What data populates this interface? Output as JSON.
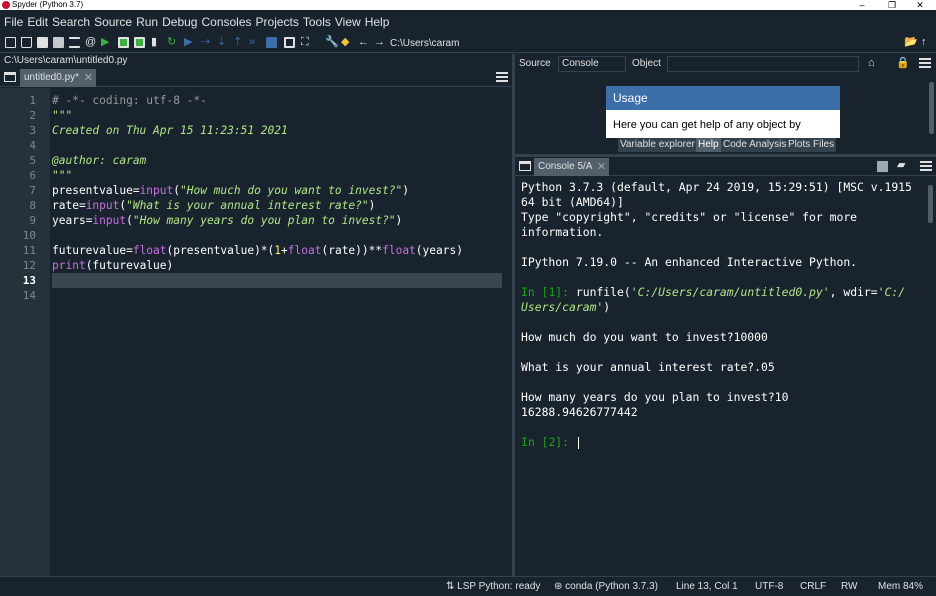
{
  "window": {
    "title": "Spyder (Python 3.7)",
    "controls": [
      "–",
      "❐",
      "✕"
    ]
  },
  "menu": [
    "File",
    "Edit",
    "Search",
    "Source",
    "Run",
    "Debug",
    "Consoles",
    "Projects",
    "Tools",
    "View",
    "Help"
  ],
  "toolbar": {
    "path": "C:\\Users\\caram",
    "icons": [
      "new-file-icon",
      "open-file-icon",
      "save-icon",
      "save-all-icon",
      "file-list-icon",
      "at-icon",
      "run-icon",
      "run-cell-icon",
      "run-cell-advance-icon",
      "run-selection-icon",
      "rerun-icon",
      "debug-icon",
      "step-icon",
      "step-into-icon",
      "step-return-icon",
      "continue-icon",
      "stop-icon",
      "maximize-pane-icon",
      "fullscreen-icon",
      "preferences-icon",
      "python-path-icon",
      "back-icon",
      "forward-icon",
      "browse-folder-icon",
      "parent-folder-icon"
    ]
  },
  "editor": {
    "file_path": "C:\\Users\\caram\\untitled0.py",
    "tab_label": "untitled0.py*",
    "line_numbers": [
      "1",
      "2",
      "3",
      "4",
      "5",
      "6",
      "7",
      "8",
      "9",
      "10",
      "11",
      "12",
      "13",
      "14"
    ],
    "current_line": 13,
    "lines": [
      [
        {
          "t": "# -*- coding: utf-8 -*-",
          "c": "c-cmt"
        }
      ],
      [
        {
          "t": "\"\"\"",
          "c": "c-str"
        }
      ],
      [
        {
          "t": "Created on Thu Apr 15 11:23:51 2021",
          "c": "c-str"
        }
      ],
      [],
      [
        {
          "t": "@author: caram",
          "c": "c-str"
        }
      ],
      [
        {
          "t": "\"\"\"",
          "c": "c-str"
        }
      ],
      [
        {
          "t": "presentvalue=",
          "c": "c-op"
        },
        {
          "t": "input",
          "c": "c-kw"
        },
        {
          "t": "(",
          "c": "c-op"
        },
        {
          "t": "\"How much do you want to invest?\"",
          "c": "c-str"
        },
        {
          "t": ")",
          "c": "c-op"
        }
      ],
      [
        {
          "t": "rate=",
          "c": "c-op"
        },
        {
          "t": "input",
          "c": "c-kw"
        },
        {
          "t": "(",
          "c": "c-op"
        },
        {
          "t": "\"What is your annual interest rate?\"",
          "c": "c-str"
        },
        {
          "t": ")",
          "c": "c-op"
        }
      ],
      [
        {
          "t": "years=",
          "c": "c-op"
        },
        {
          "t": "input",
          "c": "c-kw"
        },
        {
          "t": "(",
          "c": "c-op"
        },
        {
          "t": "\"How many years do you plan to invest?\"",
          "c": "c-str"
        },
        {
          "t": ")",
          "c": "c-op"
        }
      ],
      [],
      [
        {
          "t": "futurevalue=",
          "c": "c-op"
        },
        {
          "t": "float",
          "c": "c-kw"
        },
        {
          "t": "(presentvalue)*(",
          "c": "c-op"
        },
        {
          "t": "1",
          "c": "c-num"
        },
        {
          "t": "+",
          "c": "c-op"
        },
        {
          "t": "float",
          "c": "c-kw"
        },
        {
          "t": "(rate))**",
          "c": "c-op"
        },
        {
          "t": "float",
          "c": "c-kw"
        },
        {
          "t": "(years)",
          "c": "c-op"
        }
      ],
      [
        {
          "t": "print",
          "c": "c-kw"
        },
        {
          "t": "(futurevalue)",
          "c": "c-op"
        }
      ],
      [],
      []
    ]
  },
  "help": {
    "source_label": "Source",
    "source_value": "Console",
    "object_label": "Object",
    "object_value": "",
    "usage_title": "Usage",
    "usage_text": "Here you can get help of any object by",
    "tabs": [
      "Variable explorer",
      "Help",
      "Code Analysis",
      "Plots",
      "Files"
    ],
    "active_tab": "Help"
  },
  "console": {
    "tab_label": "Console 5/A",
    "lines": [
      [
        {
          "t": "Python 3.7.3 (default, Apr 24 2019, 15:29:51) [MSC v.1915",
          "c": ""
        }
      ],
      [
        {
          "t": "64 bit (AMD64)]",
          "c": ""
        }
      ],
      [
        {
          "t": "Type \"copyright\", \"credits\" or \"license\" for more",
          "c": ""
        }
      ],
      [
        {
          "t": "information.",
          "c": ""
        }
      ],
      [],
      [
        {
          "t": "IPython 7.19.0 -- An enhanced Interactive Python.",
          "c": ""
        }
      ],
      [],
      [
        {
          "t": "In [",
          "c": "p-in"
        },
        {
          "t": "1",
          "c": "p-in"
        },
        {
          "t": "]: ",
          "c": "p-in"
        },
        {
          "t": "runfile(",
          "c": ""
        },
        {
          "t": "'C:/Users/caram/untitled0.py'",
          "c": "p-str"
        },
        {
          "t": ", wdir=",
          "c": ""
        },
        {
          "t": "'C:/",
          "c": "p-str"
        }
      ],
      [
        {
          "t": "Users/caram'",
          "c": "p-str"
        },
        {
          "t": ")",
          "c": ""
        }
      ],
      [],
      [
        {
          "t": "How much do you want to invest?10000",
          "c": ""
        }
      ],
      [],
      [
        {
          "t": "What is your annual interest rate?.05",
          "c": ""
        }
      ],
      [],
      [
        {
          "t": "How many years do you plan to invest?10",
          "c": ""
        }
      ],
      [
        {
          "t": "16288.94626777442",
          "c": ""
        }
      ],
      [],
      [
        {
          "t": "In [",
          "c": "p-in"
        },
        {
          "t": "2",
          "c": "p-in"
        },
        {
          "t": "]: ",
          "c": "p-in"
        }
      ]
    ]
  },
  "status": {
    "lsp": "LSP Python: ready",
    "conda": "conda (Python 3.7.3)",
    "position": "Line 13, Col 1",
    "encoding": "UTF-8",
    "eol": "CRLF",
    "permissions": "RW",
    "memory": "Mem 84%"
  },
  "colors": {
    "background": "#19232d",
    "usage_header": "#3c6ea8",
    "prompt_green": "#18a418",
    "string_green": "#b0e686",
    "keyword_purple": "#c670e0"
  }
}
